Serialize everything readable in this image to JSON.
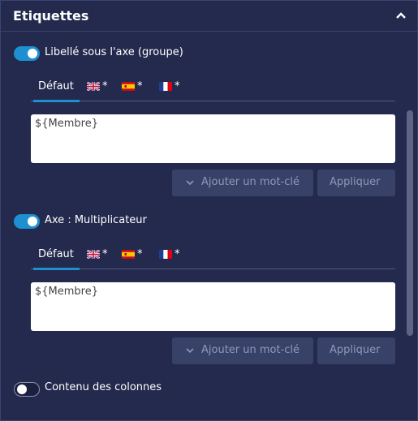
{
  "header": {
    "title": "Etiquettes"
  },
  "sections": [
    {
      "toggle_label": "Libellé sous l'axe (groupe)",
      "toggle_on": true,
      "tabs": {
        "default": "Défaut",
        "lang_star": "*"
      },
      "text_value": "${Membre}",
      "keyword_button": "Ajouter un mot-clé",
      "apply_button": "Appliquer"
    },
    {
      "toggle_label": "Axe : Multiplicateur",
      "toggle_on": true,
      "tabs": {
        "default": "Défaut",
        "lang_star": "*"
      },
      "text_value": "${Membre}",
      "keyword_button": "Ajouter un mot-clé",
      "apply_button": "Appliquer"
    }
  ],
  "columns_toggle": {
    "label": "Contenu des colonnes",
    "on": false
  },
  "flags": [
    "uk-flag-icon",
    "spain-flag-icon",
    "france-flag-icon"
  ],
  "colors": {
    "background": "#232a4d",
    "accent": "#1e8fd0",
    "button": "#384268",
    "button_text": "#8f98b8"
  }
}
